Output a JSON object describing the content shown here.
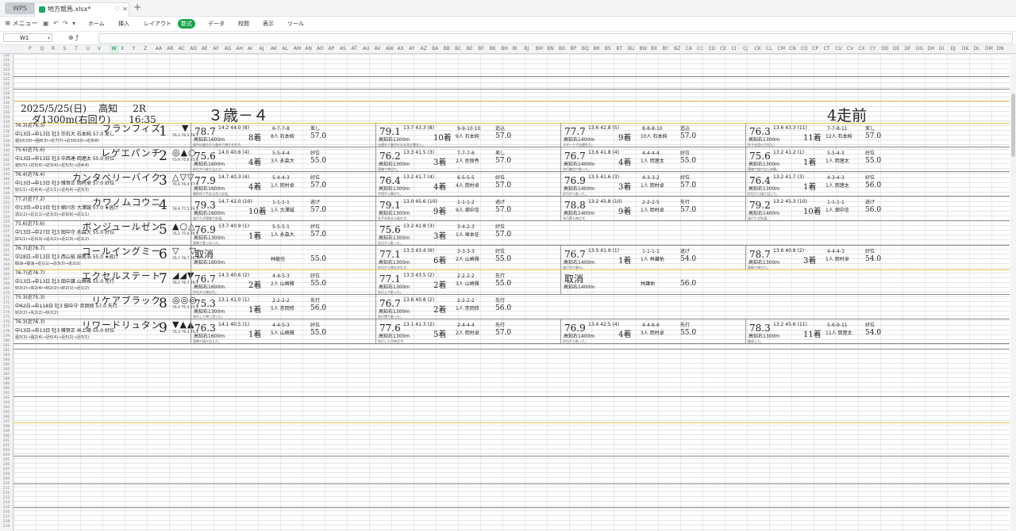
{
  "app": {
    "name": "WPS",
    "file_tab": "地方競馬.xlsx*"
  },
  "menu": {
    "label": "メニュー",
    "tabs": [
      "ホーム",
      "挿入",
      "レイアウト",
      "数式",
      "データ",
      "校閲",
      "表示",
      "ツール"
    ],
    "active_tab": "数式"
  },
  "formula": {
    "cell_ref": "W1"
  },
  "columns": [
    "P",
    "Q",
    "R",
    "S",
    "T",
    "U",
    "V",
    "W",
    "X",
    "Y",
    "Z",
    "AA",
    "AB",
    "AC",
    "AD",
    "AE",
    "AF",
    "AG",
    "AH",
    "AI",
    "AJ",
    "AK",
    "AL",
    "AM",
    "AN",
    "AO",
    "AP",
    "AS",
    "AT",
    "AU",
    "AV",
    "AW",
    "AX",
    "AY",
    "AZ",
    "BA",
    "BB",
    "BC",
    "BE",
    "BF",
    "BK",
    "BH",
    "BI",
    "BJ",
    "BM",
    "BN",
    "BO",
    "BP",
    "BQ",
    "BR",
    "BS",
    "BT",
    "BU",
    "BW",
    "BX",
    "BY",
    "BZ",
    "CA",
    "CC",
    "CD",
    "CE",
    "CI",
    "CJ",
    "CK",
    "CL",
    "CM",
    "CN",
    "CO",
    "CP",
    "CT",
    "CU",
    "CV",
    "CX",
    "CY",
    "DD",
    "DE",
    "DF",
    "DG",
    "DH",
    "DI",
    "DJ",
    "DK",
    "DL",
    "DM",
    "DN"
  ],
  "selected_column": "W",
  "header": {
    "date": "2025/5/25(日)",
    "venue": "高知",
    "race_no": "2R",
    "course": "ダ1300m(右回り)",
    "time": "16:35",
    "class": "３歳－４",
    "prev": "4走前"
  },
  "horses": [
    {
      "no": "1",
      "rating": "76.3(近76.3)",
      "name": "フランフィズ",
      "info": "中13日→中13日 牡3 宗石大 石本純 57.0 差し",
      "sub": "過10(10)→過8(3)→近7(7)→近10(10)→近9(8)",
      "marks": "　▼　",
      "ratings": "76.2 76.3 78.7",
      "races": [
        {
          "idx": "78.7",
          "info": "14.2 44.0 (8)",
          "dist": "高知右1600m",
          "fin": "8着",
          "pos": "6-7-7-8",
          "jock": "8人 石本純",
          "wt": "57.0",
          "pace": "差し",
          "comment": "道中は後方から進めて伸びきれず。"
        },
        {
          "idx": "79.1",
          "info": "13.7 43.3 (8)",
          "dist": "高知右1300m",
          "fin": "10着",
          "pos": "9-9-10-10",
          "jock": "9人 石本純",
          "wt": "57.0",
          "pace": "追込",
          "comment": "出遅れて後方のまま見せ場なし。"
        },
        {
          "idx": "77.7",
          "info": "13.6 42.8 (5)",
          "dist": "高知右1400m",
          "fin": "9着",
          "pos": "8-8-8-10",
          "jock": "10人 石本純",
          "wt": "57.0",
          "pace": "追込",
          "comment": "スタートで出遅れた。"
        },
        {
          "idx": "76.3",
          "info": "13.6 43.3 (11)",
          "dist": "高知右1300m",
          "fin": "11着",
          "pos": "7-7-8-11",
          "jock": "12人 石本純",
          "wt": "57.0",
          "pace": "差し",
          "comment": "外々を回らされた。"
        }
      ]
    },
    {
      "no": "2",
      "rating": "75.6(近75.6)",
      "name": "レゲエパンチ",
      "info": "中13日→中13日 牡3 中西達 岡遼太 55.0 好位",
      "sub": "過5(5)→近5(4)→近3(4)→近5(5)→近4(4)",
      "marks": "◎▲○",
      "ratings": "73.9 75.6 75.6",
      "races": [
        {
          "idx": "75.6",
          "info": "14.0 40.6 (4)",
          "dist": "高知右1600m",
          "fin": "4着",
          "pos": "5-5-4-4",
          "jock": "3人 永森大",
          "wt": "55.0",
          "pace": "好位",
          "comment": "好位から粘り込んだ。"
        },
        {
          "idx": "76.2",
          "info": "13.3 41.5 (3)",
          "dist": "高知右1300m",
          "fin": "3着",
          "pos": "7-7-7-6",
          "jock": "2人 佐原秀",
          "wt": "57.0",
          "pace": "差し",
          "comment": "直線で伸びた。"
        },
        {
          "idx": "76.7",
          "info": "13.6 41.8 (4)",
          "dist": "高知右1400m",
          "fin": "4着",
          "pos": "4-4-4-4",
          "jock": "1人 岡遼太",
          "wt": "55.0",
          "pace": "好位",
          "comment": "先行集団で粘った。"
        },
        {
          "idx": "75.6",
          "info": "13.2 41.2 (1)",
          "dist": "高知右1300m",
          "fin": "1着",
          "pos": "5-5-4-3",
          "jock": "1人 岡遼太",
          "wt": "55.0",
          "pace": "好位",
          "comment": "直線で抜け出し快勝。"
        }
      ]
    },
    {
      "no": "3",
      "rating": "76.4(近76.4)",
      "name": "カンタベリーバイク",
      "info": "中13日→中13日 牡3 雑賀正 岡村卓 57.0 好位",
      "sub": "好1(1)→近4(4)→近1(1)→近4(4)→近3(3)",
      "marks": "△▽▽",
      "ratings": "76.6 76.4 77.9",
      "races": [
        {
          "idx": "77.9",
          "info": "14.7 40.3 (4)",
          "dist": "高知右1600m",
          "fin": "4着",
          "pos": "5-4-4-3",
          "jock": "1人 岡村卓",
          "wt": "57.0",
          "pace": "好位",
          "comment": "勝負所で手応え良く好走。"
        },
        {
          "idx": "76.4",
          "info": "13.2 41.7 (4)",
          "dist": "高知右1300m",
          "fin": "4着",
          "pos": "6-5-5-5",
          "jock": "4人 岡村卓",
          "wt": "57.0",
          "pace": "好位",
          "comment": "中団から伸びた。"
        },
        {
          "idx": "76.9",
          "info": "13.5 41.6 (3)",
          "dist": "高知右1400m",
          "fin": "3着",
          "pos": "4-3-3-2",
          "jock": "1人 岡村卓",
          "wt": "57.0",
          "pace": "好位",
          "comment": "好位から粘った。"
        },
        {
          "idx": "76.4",
          "info": "13.2 41.7 (3)",
          "dist": "高知右1300m",
          "fin": "1着",
          "pos": "4-3-4-3",
          "jock": "1人 岡遼太",
          "wt": "56.0",
          "pace": "好位",
          "comment": "好位から抜け出した。"
        }
      ]
    },
    {
      "no": "4",
      "rating": "77.2(近77.2)",
      "name": "カワノムコウニ",
      "info": "中13日→中13日 牡3 細川忠 大澤誠 57.0 ★逃げ",
      "sub": "逃1(2)→近1(1)→近3(3)→近9(9)→近1(1)",
      "marks": "　　　",
      "ratings": "78.9 77.2 79.3",
      "races": [
        {
          "idx": "79.3",
          "info": "14.7 42.0 (10)",
          "dist": "高知右1600m",
          "fin": "10着",
          "pos": "1-1-1-1",
          "jock": "1人 大澤誠",
          "wt": "57.0",
          "pace": "逃げ",
          "comment": "逃げたが直線で失速。"
        },
        {
          "idx": "79.1",
          "info": "13.0 45.6 (10)",
          "dist": "高知右1300m",
          "fin": "9着",
          "pos": "1-1-1-2",
          "jock": "9人 畑中信",
          "wt": "57.0",
          "pace": "逃げ",
          "comment": "先手を取るも粘れず。"
        },
        {
          "idx": "78.8",
          "info": "13.2 45.8 (10)",
          "dist": "高知右1400m",
          "fin": "9着",
          "pos": "2-2-2-5",
          "jock": "1人 岡村卓",
          "wt": "57.0",
          "pace": "先行",
          "comment": "先行策も伸びず。"
        },
        {
          "idx": "79.2",
          "info": "13.2 45.3 (10)",
          "dist": "高知右1400m",
          "fin": "10着",
          "pos": "1-1-1-1",
          "jock": "1人 畑中信",
          "wt": "56.0",
          "pace": "逃げ",
          "comment": "逃げたが失速。"
        }
      ]
    },
    {
      "no": "5",
      "rating": "75.6(近75.6)",
      "name": "ボンジュールゼン",
      "info": "中13日→中27日 牡3 田中守 永森大 55.0 好位",
      "sub": "好1(1)→近3(3)→近2(2)→近2(3)→近2(2)",
      "marks": "▲○△",
      "ratings": "76.2 75.6 76.9",
      "races": [
        {
          "idx": "76.9",
          "info": "13.7 40.9 (1)",
          "dist": "高知右1300m",
          "fin": "1着",
          "pos": "5-5-5-1",
          "jock": "1人 永森大",
          "wt": "57.0",
          "pace": "好位",
          "comment": "直線で差し切った。"
        },
        {
          "idx": "75.6",
          "info": "13.2 41.8 (3)",
          "dist": "高知右1300m",
          "fin": "3着",
          "pos": "3-4-2-3",
          "jock": "1人 塚本征",
          "wt": "57.0",
          "pace": "好位",
          "comment": "好位から粘った。"
        }
      ]
    },
    {
      "no": "6",
      "rating": "76.7(近76.7)",
      "name": "コールイングミー",
      "info": "中28日→中13日 牡3 西山裕 妹尾浩 55.0 ★逃げ",
      "sub": "取消→取消→近1(1)→近3(3)→近2(2)",
      "marks": "▽　▽",
      "ratings": "76.7 76.7 76.7",
      "races": [
        {
          "idx": "取消",
          "info": "",
          "dist": "高知右1600m",
          "fin": "",
          "pos": "",
          "jock": "林龍也",
          "wt": "55.0",
          "pace": "",
          "comment": ""
        },
        {
          "idx": "77.1",
          "info": "13.3 43.4 (6)",
          "dist": "高知右1300m",
          "fin": "6着",
          "pos": "3-3-3-3",
          "jock": "2人 山崎雅",
          "wt": "55.0",
          "pace": "好位",
          "comment": "好位から伸びきれず。"
        },
        {
          "idx": "76.7",
          "info": "13.5 41.9 (1)",
          "dist": "高知右1400m",
          "fin": "1着",
          "pos": "1-1-1-1",
          "jock": "1人 林謙佑",
          "wt": "54.0",
          "pace": "逃げ",
          "comment": "逃げ切り勝ち。"
        },
        {
          "idx": "78.7",
          "info": "13.6 40.8 (2)",
          "dist": "高知右1300m",
          "fin": "3着",
          "pos": "4-4-4-3",
          "jock": "1人 岡村卓",
          "wt": "54.0",
          "pace": "好位",
          "comment": "直線で伸びた。"
        }
      ]
    },
    {
      "no": "7",
      "rating": "76.7(近76.7)",
      "name": "エクセルステート",
      "info": "中13日→中13日 牡3 田中譲 山崎雅 55.0 先行",
      "sub": "好2(2)→先2(4)→好2(2)→好2(1)→近1(2)",
      "marks": "◢◢▼",
      "ratings": "78.2 76.7 76.7",
      "races": [
        {
          "idx": "76.7",
          "info": "14.3 40.6 (2)",
          "dist": "高知右1600m",
          "fin": "2着",
          "pos": "4-4-5-3",
          "jock": "2人 山崎雅",
          "wt": "55.0",
          "pace": "好位",
          "comment": "好位から伸びた。"
        },
        {
          "idx": "77.1",
          "info": "13.3 43.5 (2)",
          "dist": "高知右1300m",
          "fin": "2着",
          "pos": "2-2-2-2",
          "jock": "3人 山崎雅",
          "wt": "55.0",
          "pace": "先行",
          "comment": "先行して粘った。"
        },
        {
          "idx": "取消",
          "info": "",
          "dist": "高知右1400m",
          "fin": "",
          "pos": "",
          "jock": "林謙佑",
          "wt": "56.0",
          "pace": "",
          "comment": ""
        }
      ]
    },
    {
      "no": "8",
      "rating": "75.3(近75.3)",
      "name": "リケアブラック",
      "info": "中62日→中118日 牡3 田中守 赤岡修 57.0 先行",
      "sub": "好2(2)→先2(2)→好2(2)",
      "marks": "◎◎◎",
      "ratings": "76.2 75.3 75.3",
      "races": [
        {
          "idx": "75.3",
          "info": "13.1 41.0 (1)",
          "dist": "高知右1300m",
          "fin": "1着",
          "pos": "2-2-2-2",
          "jock": "5人 赤岡修",
          "wt": "56.0",
          "pace": "先行",
          "comment": "先行して押し切った。"
        },
        {
          "idx": "76.7",
          "info": "13.6 40.8 (2)",
          "dist": "高知右1300m",
          "fin": "2着",
          "pos": "2-2-2-2",
          "jock": "1人 赤岡修",
          "wt": "56.0",
          "pace": "先行",
          "comment": "先行策で粘った。"
        }
      ]
    },
    {
      "no": "9",
      "rating": "76.3(近76.3)",
      "name": "リワードリュタン",
      "info": "中13日→中13日 牡3 雑賀正 井上瑛 55.0 好位",
      "sub": "過3(3)→過2(4)→近6(4)→近5(2)→近5(5)",
      "marks": "▼▲▲",
      "ratings": "76.3 76.3 76.3",
      "races": [
        {
          "idx": "76.3",
          "info": "14.1 40.5 (1)",
          "dist": "高知右1600m",
          "fin": "1着",
          "pos": "4-4-5-3",
          "jock": "5人 山崎雅",
          "wt": "55.0",
          "pace": "好位",
          "comment": "直線で抜け出した。"
        },
        {
          "idx": "77.6",
          "info": "13.1 41.3 (2)",
          "dist": "高知右1300m",
          "fin": "5着",
          "pos": "2-4-4-4",
          "jock": "2人 岡村卓",
          "wt": "57.0",
          "pace": "先行",
          "comment": "先行したが伸びず。"
        },
        {
          "idx": "76.9",
          "info": "13.4 42.5 (4)",
          "dist": "高知右1400m",
          "fin": "4着",
          "pos": "4-4-6-6",
          "jock": "3人 岡村卓",
          "wt": "55.0",
          "pace": "先行",
          "comment": "好位から粘った。"
        },
        {
          "idx": "78.3",
          "info": "13.2 45.6 (11)",
          "dist": "高知右1300m",
          "fin": "11着",
          "pos": "5-6-9-11",
          "jock": "11人 岡遼太",
          "wt": "54.0",
          "pace": "好位",
          "comment": "後退した。"
        }
      ]
    }
  ]
}
